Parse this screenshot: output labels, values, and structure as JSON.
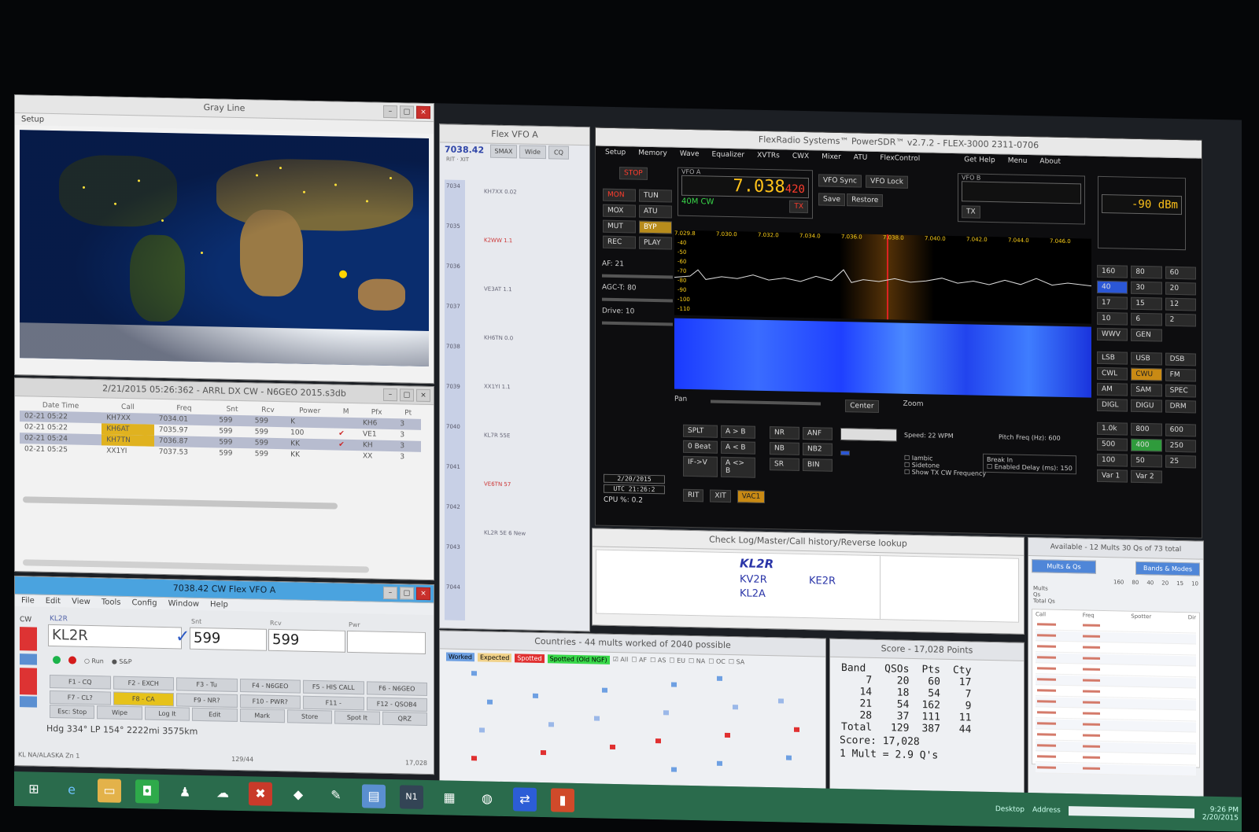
{
  "grayline": {
    "title": "Gray Line",
    "menu": "Setup"
  },
  "log": {
    "title": "2/21/2015 05:26:362 - ARRL DX CW - N6GEO 2015.s3db",
    "headers": [
      "Date Time",
      "Call",
      "Freq",
      "Snt",
      "Rcv",
      "Power",
      "M",
      "Pfx",
      "Pt"
    ],
    "rows": [
      {
        "time": "02-21 05:22",
        "call": "KH7XX",
        "freq": "7034.01",
        "snt": "599",
        "rcv": "599",
        "pwr": "K",
        "pfx": "KH6",
        "pt": "3"
      },
      {
        "time": "02-21 05:22",
        "call": "KH6AT",
        "freq": "7035.97",
        "snt": "599",
        "rcv": "599",
        "pwr": "100",
        "pfx": "VE1",
        "pt": "3"
      },
      {
        "time": "02-21 05:24",
        "call": "KH7TN",
        "freq": "7036.87",
        "snt": "599",
        "rcv": "599",
        "pwr": "KK",
        "pfx": "KH",
        "pt": "3"
      },
      {
        "time": "02-21 05:25",
        "call": "XX1YI",
        "freq": "7037.53",
        "snt": "599",
        "rcv": "599",
        "pwr": "KK",
        "pfx": "XX",
        "pt": "3"
      }
    ]
  },
  "entry": {
    "title": "7038.42 CW Flex VFO A",
    "menu": [
      "File",
      "Edit",
      "View",
      "Tools",
      "Config",
      "Window",
      "Help"
    ],
    "mode": "CW",
    "call_label": "KL2R",
    "call": "KL2R",
    "snt_label": "Snt",
    "snt": "599",
    "rcv_label": "Rcv",
    "rcv": "599",
    "pwr_label": "Pwr",
    "run": "Run",
    "sp": "S&P",
    "fkeys": [
      "F1 - CQ",
      "F2 - EXCH",
      "F3 - Tu",
      "F4 - N6GEO",
      "F5 - HIS CALL",
      "F6 - N6GEO",
      "F7 - CL?",
      "F8 - CA",
      "F9 - NR?",
      "F10 - PWR?",
      "F11 -",
      "F12 - QSOB4"
    ],
    "row3": [
      "Esc: Stop",
      "Wipe",
      "Log It",
      "Edit",
      "Mark",
      "Store",
      "Spot It",
      "QRZ"
    ],
    "heading": "Hdg 334° LP 154° 2222mi 3575km",
    "status_left": "KL NA/ALASKA Zn 1",
    "status_mid": "129/44",
    "status_right": "17,028"
  },
  "vfo": {
    "title": "Flex VFO A",
    "freq": "7038.42",
    "btns": [
      "SMAX",
      "Wide",
      "CQ"
    ],
    "rit": "RIT",
    "xit": "XIT",
    "ticks": [
      "7034",
      "7035",
      "7036",
      "7037",
      "7038",
      "7039",
      "7040",
      "7041",
      "7042",
      "7043",
      "7044"
    ],
    "spots": [
      "KH7XX 0.02",
      "K2WW 1.1",
      "VE3AT 1.1",
      "KH6TN 0.0",
      "XX1YI 1.1",
      "KL7R 55E",
      "VE6TN 57",
      "KL2R 5E 6 New"
    ]
  },
  "sdr": {
    "title": "FlexRadio Systems™ PowerSDR™ v2.7.2 - FLEX-3000 2311-0706",
    "menu": [
      "Setup",
      "Memory",
      "Wave",
      "Equalizer",
      "XVTRs",
      "CWX",
      "Mixer",
      "ATU",
      "FlexControl",
      "Get Help",
      "Menu",
      "About"
    ],
    "stop": "STOP",
    "left_btns": [
      "MON",
      "TUN",
      "MOX",
      "ATU",
      "MUT",
      "BYP",
      "REC",
      "PLAY"
    ],
    "vfoa_label": "VFO A",
    "vfoa_freq": "7.038",
    "vfoa_sub": "420",
    "band": "40M CW",
    "tx": "TX",
    "vfo_sync": "VFO Sync",
    "vfo_lock": "VFO Lock",
    "save": "Save",
    "restore": "Restore",
    "vfob_label": "VFO B",
    "meter": "-90 dBm",
    "af": "AF: 21",
    "agc": "AGC-T: 80",
    "drive": "Drive: 10",
    "freq_axis": [
      "7.029.8",
      "7.030.0",
      "7.032.0",
      "7.034.0",
      "7.036.0",
      "7.038.0",
      "7.040.0",
      "7.042.0",
      "7.044.0",
      "7.046.0"
    ],
    "db_axis": [
      "-40",
      "-50",
      "-60",
      "-70",
      "-80",
      "-90",
      "-100",
      "-110"
    ],
    "pan": "Pan",
    "center": "Center",
    "zoom": "Zoom",
    "split_btns": [
      "SPLT",
      "A > B",
      "0 Beat",
      "A < B",
      "IF->V",
      "A <> B"
    ],
    "nr_btns": [
      "NR",
      "ANF",
      "NB",
      "NB2",
      "SR",
      "BIN"
    ],
    "filter_btns": [
      "SPLT",
      "RIT",
      "XIT"
    ],
    "speed": "Speed: 22 WPM",
    "pitch": "Pitch Freq (Hz): 600",
    "iambic": "Iambic",
    "sidetone": "Sidetone",
    "show_tx": "Show TX CW Frequency",
    "breakin": "Break In",
    "enabled": "Enabled",
    "delay": "Delay (ms): 150",
    "date": "2/20/2015",
    "time": "UTC 21:26:2",
    "cpu": "CPU %: 0.2",
    "vac": "VAC1",
    "filters": [
      "1.0k",
      "800",
      "600",
      "500",
      "400",
      "250",
      "100",
      "50",
      "25",
      "Var 1",
      "Var 2"
    ],
    "modes": [
      "LSB",
      "USB",
      "DSB",
      "CWL",
      "CWU",
      "FM",
      "AM",
      "SAM",
      "SPEC",
      "DIGL",
      "DIGU",
      "DRM"
    ],
    "bands": [
      "160",
      "80",
      "60",
      "40",
      "30",
      "20",
      "17",
      "15",
      "12",
      "10",
      "6",
      "2",
      "WWV",
      "GEN"
    ]
  },
  "check": {
    "title": "Check Log/Master/Call history/Reverse lookup",
    "main": "KL2R",
    "alt1": "KV2R",
    "alt2": "KL2A",
    "alt3": "KE2R"
  },
  "countries": {
    "title": "Countries - 44 mults worked of 2040 possible",
    "legend": [
      "Worked",
      "Expected",
      "Spotted",
      "Spotted (Old NGF)"
    ],
    "filters": [
      "All",
      "AF",
      "AS",
      "EU",
      "NA",
      "OC",
      "SA"
    ]
  },
  "score": {
    "title": "Score - 17,028 Points",
    "headers": [
      "Band",
      "QSOs",
      "Pts",
      "Cty"
    ],
    "rows": [
      [
        "7",
        "20",
        "60",
        "17"
      ],
      [
        "14",
        "18",
        "54",
        "7"
      ],
      [
        "21",
        "54",
        "162",
        "9"
      ],
      [
        "28",
        "37",
        "111",
        "11"
      ],
      [
        "Total",
        "129",
        "387",
        "44"
      ]
    ],
    "score_line": "Score: 17,028",
    "mult_line": "1 Mult = 2.9 Q's"
  },
  "available": {
    "title": "Available - 12 Mults 30 Qs of 73 total",
    "btn1": "Mults & Qs",
    "btn2": "Bands & Modes",
    "bands": [
      "160",
      "80",
      "40",
      "20",
      "15",
      "10"
    ],
    "rows": [
      "Mults",
      "Qs",
      "Total Qs"
    ],
    "col_heads": [
      "Call",
      "Freq",
      "Spotter",
      "Dir"
    ]
  },
  "taskbar": {
    "desktop": "Desktop",
    "address": "Address",
    "time": "9:26 PM",
    "date": "2/20/2015"
  }
}
